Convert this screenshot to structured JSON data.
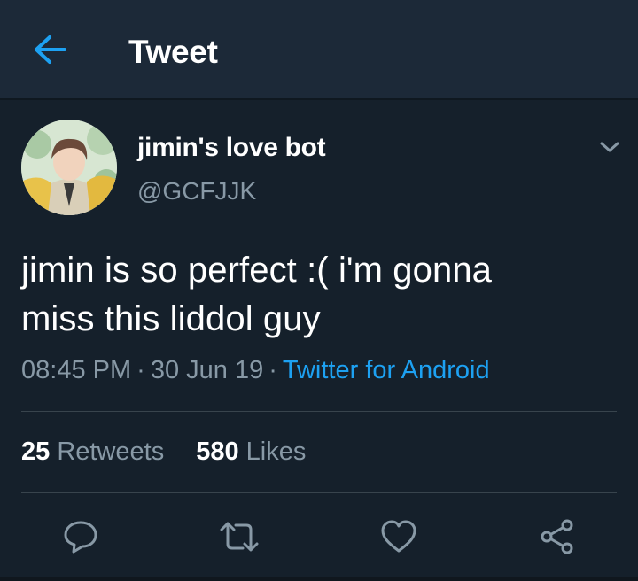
{
  "header": {
    "title": "Tweet",
    "back_icon": "arrow-left-icon",
    "accent": "#1da1f2"
  },
  "tweet": {
    "author": {
      "display_name": "jimin's love bot",
      "handle": "@GCFJJK"
    },
    "text_line_1": "jimin is so perfect :( i'm gonna",
    "text_line_2": "miss this liddol guy",
    "time": "08:45 PM",
    "separator": "·",
    "date": "30 Jun 19",
    "source": "Twitter for Android",
    "stats": {
      "retweets_count": "25",
      "retweets_label": "Retweets",
      "likes_count": "580",
      "likes_label": "Likes"
    },
    "actions": [
      "reply-icon",
      "retweet-icon",
      "like-icon",
      "share-icon"
    ]
  },
  "colors": {
    "background": "#15202b",
    "header_background": "#1c2938",
    "secondary_text": "#8899a6",
    "divider": "#38444d"
  }
}
